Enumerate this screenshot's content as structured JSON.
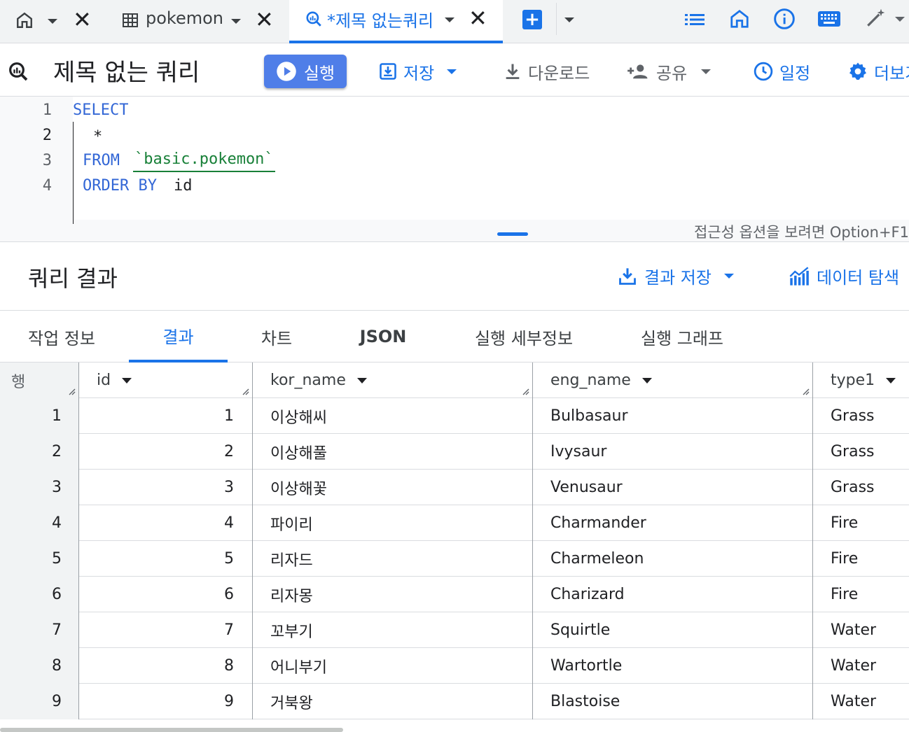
{
  "tabs": [
    {
      "label": ""
    },
    {
      "label": "pokemon"
    },
    {
      "label": "*제목 없는쿼리"
    }
  ],
  "toolbar": {
    "title": "제목 없는 쿼리",
    "run": "실행",
    "save": "저장",
    "download": "다운로드",
    "share": "공유",
    "schedule": "일정",
    "more": "더보기"
  },
  "editor": {
    "lines": [
      {
        "n": "1",
        "kw": "SELECT",
        "rest": ""
      },
      {
        "n": "2",
        "kw": "",
        "rest": "*"
      },
      {
        "n": "3",
        "kw": "FROM",
        "rest": "`basic.pokemon`"
      },
      {
        "n": "4",
        "kw": "ORDER BY",
        "rest": "id"
      }
    ],
    "a11y_hint": "접근성 옵션을 보려면 Option+F1"
  },
  "results": {
    "title": "쿼리 결과",
    "save_results": "결과 저장",
    "explore": "데이터 탐색",
    "tabs": [
      "작업 정보",
      "결과",
      "차트",
      "JSON",
      "실행 세부정보",
      "실행 그래프"
    ],
    "active_tab": "결과",
    "columns": [
      "행",
      "id",
      "kor_name",
      "eng_name",
      "type1"
    ],
    "rows": [
      {
        "row": "1",
        "id": "1",
        "kor_name": "이상해씨",
        "eng_name": "Bulbasaur",
        "type1": "Grass"
      },
      {
        "row": "2",
        "id": "2",
        "kor_name": "이상해풀",
        "eng_name": "Ivysaur",
        "type1": "Grass"
      },
      {
        "row": "3",
        "id": "3",
        "kor_name": "이상해꽃",
        "eng_name": "Venusaur",
        "type1": "Grass"
      },
      {
        "row": "4",
        "id": "4",
        "kor_name": "파이리",
        "eng_name": "Charmander",
        "type1": "Fire"
      },
      {
        "row": "5",
        "id": "5",
        "kor_name": "리자드",
        "eng_name": "Charmeleon",
        "type1": "Fire"
      },
      {
        "row": "6",
        "id": "6",
        "kor_name": "리자몽",
        "eng_name": "Charizard",
        "type1": "Fire"
      },
      {
        "row": "7",
        "id": "7",
        "kor_name": "꼬부기",
        "eng_name": "Squirtle",
        "type1": "Water"
      },
      {
        "row": "8",
        "id": "8",
        "kor_name": "어니부기",
        "eng_name": "Wartortle",
        "type1": "Water"
      },
      {
        "row": "9",
        "id": "9",
        "kor_name": "거북왕",
        "eng_name": "Blastoise",
        "type1": "Water"
      }
    ]
  },
  "colors": {
    "accent": "#1a73e8",
    "run_button": "#4f7ee8",
    "keyword": "#3367d6",
    "string": "#188038"
  }
}
